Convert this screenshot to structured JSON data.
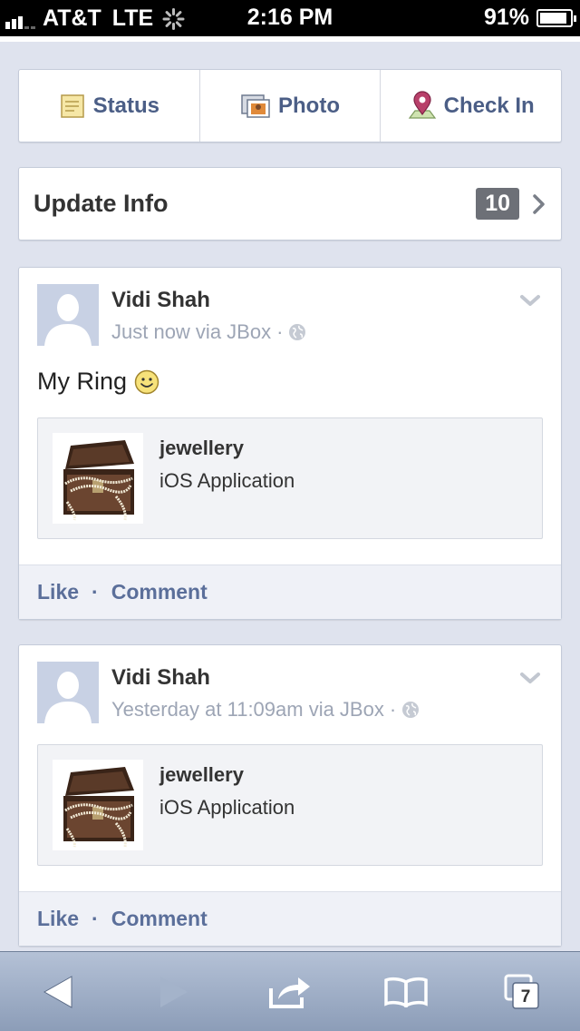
{
  "status_bar": {
    "carrier": "AT&T",
    "network": "LTE",
    "time": "2:16 PM",
    "battery": "91%",
    "battery_level": 0.91,
    "signal_bars": 3
  },
  "composer": {
    "status_label": "Status",
    "photo_label": "Photo",
    "checkin_label": "Check In"
  },
  "update_info": {
    "label": "Update Info",
    "count": "10"
  },
  "posts": [
    {
      "author": "Vidi Shah",
      "meta": "Just now via JBox",
      "dot": "·",
      "message": "My Ring",
      "attachment": {
        "title": "jewellery",
        "subtitle": "iOS Application"
      },
      "like_label": "Like",
      "comment_label": "Comment"
    },
    {
      "author": "Vidi Shah",
      "meta": "Yesterday at 11:09am via JBox",
      "dot": "·",
      "attachment": {
        "title": "jewellery",
        "subtitle": "iOS Application"
      },
      "like_label": "Like",
      "comment_label": "Comment"
    }
  ],
  "action_separator": "·",
  "toolbar": {
    "tabs_count": "7"
  },
  "colors": {
    "link": "#5b6f9a",
    "background": "#dfe3ee",
    "badge": "#6d7077"
  }
}
